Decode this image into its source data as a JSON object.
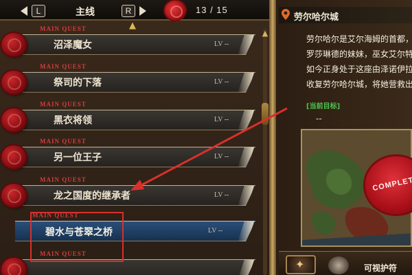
{
  "topbar": {
    "left_key": "L",
    "right_key": "R",
    "tab_title": "主线",
    "counter": "13 / 15"
  },
  "quests": [
    {
      "tag": "MAIN QUEST",
      "name": "沼泽魔女",
      "lv": "LV --"
    },
    {
      "tag": "MAIN QUEST",
      "name": "祭司的下落",
      "lv": "LV --"
    },
    {
      "tag": "MAIN QUEST",
      "name": "黑衣将领",
      "lv": "LV --"
    },
    {
      "tag": "MAIN QUEST",
      "name": "另一位王子",
      "lv": "LV --"
    },
    {
      "tag": "MAIN QUEST",
      "name": "龙之国度的继承者",
      "lv": "LV --"
    },
    {
      "tag": "MAIN QUEST",
      "name": "碧水与苍翠之桥",
      "lv": "LV --"
    },
    {
      "tag": "MAIN QUEST",
      "name": "",
      "lv": ""
    }
  ],
  "detail": {
    "location": "劳尔哈尔城",
    "description_lines": [
      "劳尔哈尔是艾尔海姆的首都，",
      "罗莎琳德的妹妹，巫女艾尔特",
      "如今正身处于这座由泽诺伊拉",
      "收复劳尔哈尔城，将她营救出"
    ],
    "goal_label": "[当前目标]",
    "goal_value": "--",
    "stamp_text": "COMPLETE",
    "footer_label": "可视护符"
  },
  "colors": {
    "quest_tag": "#d43c3c",
    "active_bar": "#2a4f7a",
    "goal_green": "#4fc24f",
    "annotation_red": "#d9302c"
  }
}
